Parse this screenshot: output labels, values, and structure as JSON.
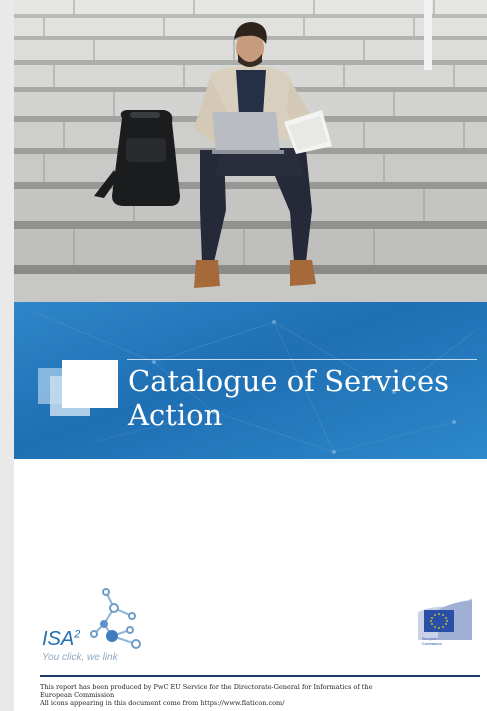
{
  "cover": {
    "title_line1": "Catalogue of Services",
    "title_line2": "Action"
  },
  "logos": {
    "isa": "ISA",
    "isa_superscript": "2",
    "isa_tagline": "You click, we link",
    "ec_line1": "European",
    "ec_line2": "Commission"
  },
  "footer": {
    "line1": "This report has been produced by PwC EU Service for the Directorate-General for Informatics of the",
    "line2": "European Commission",
    "line3": "All icons appearing in this document come from https://www.flaticon.com/"
  },
  "colors": {
    "banner_blue": "#1f6fb3",
    "divider_navy": "#1b3c6a",
    "isa_blue": "#1f6fb3",
    "eu_flag_blue": "#2a4fa6",
    "eu_star_yellow": "#f2d21c"
  }
}
